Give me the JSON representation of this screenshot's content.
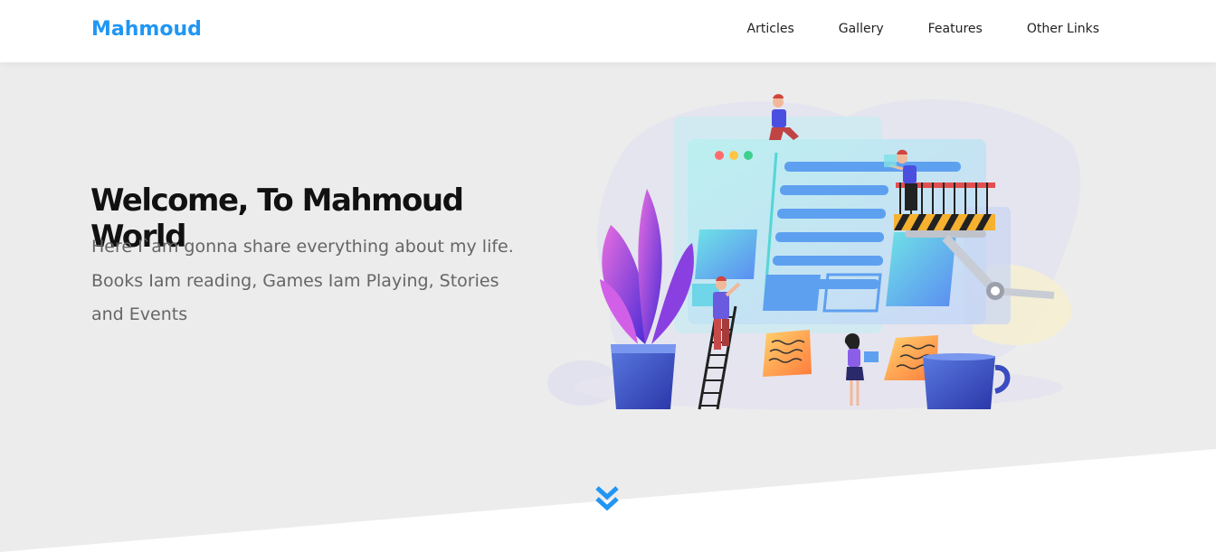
{
  "header": {
    "logo": "Mahmoud",
    "nav": [
      "Articles",
      "Gallery",
      "Features",
      "Other Links"
    ]
  },
  "hero": {
    "title": "Welcome, To Mahmoud World",
    "text": "Here I`am gonna share everything about my life. Books Iam reading, Games Iam Playing, Stories and Events"
  },
  "colors": {
    "accent": "#2196f3",
    "background": "#ececec",
    "header": "#ffffff"
  },
  "icons": {
    "scroll_down": "double-chevron-down-icon"
  }
}
